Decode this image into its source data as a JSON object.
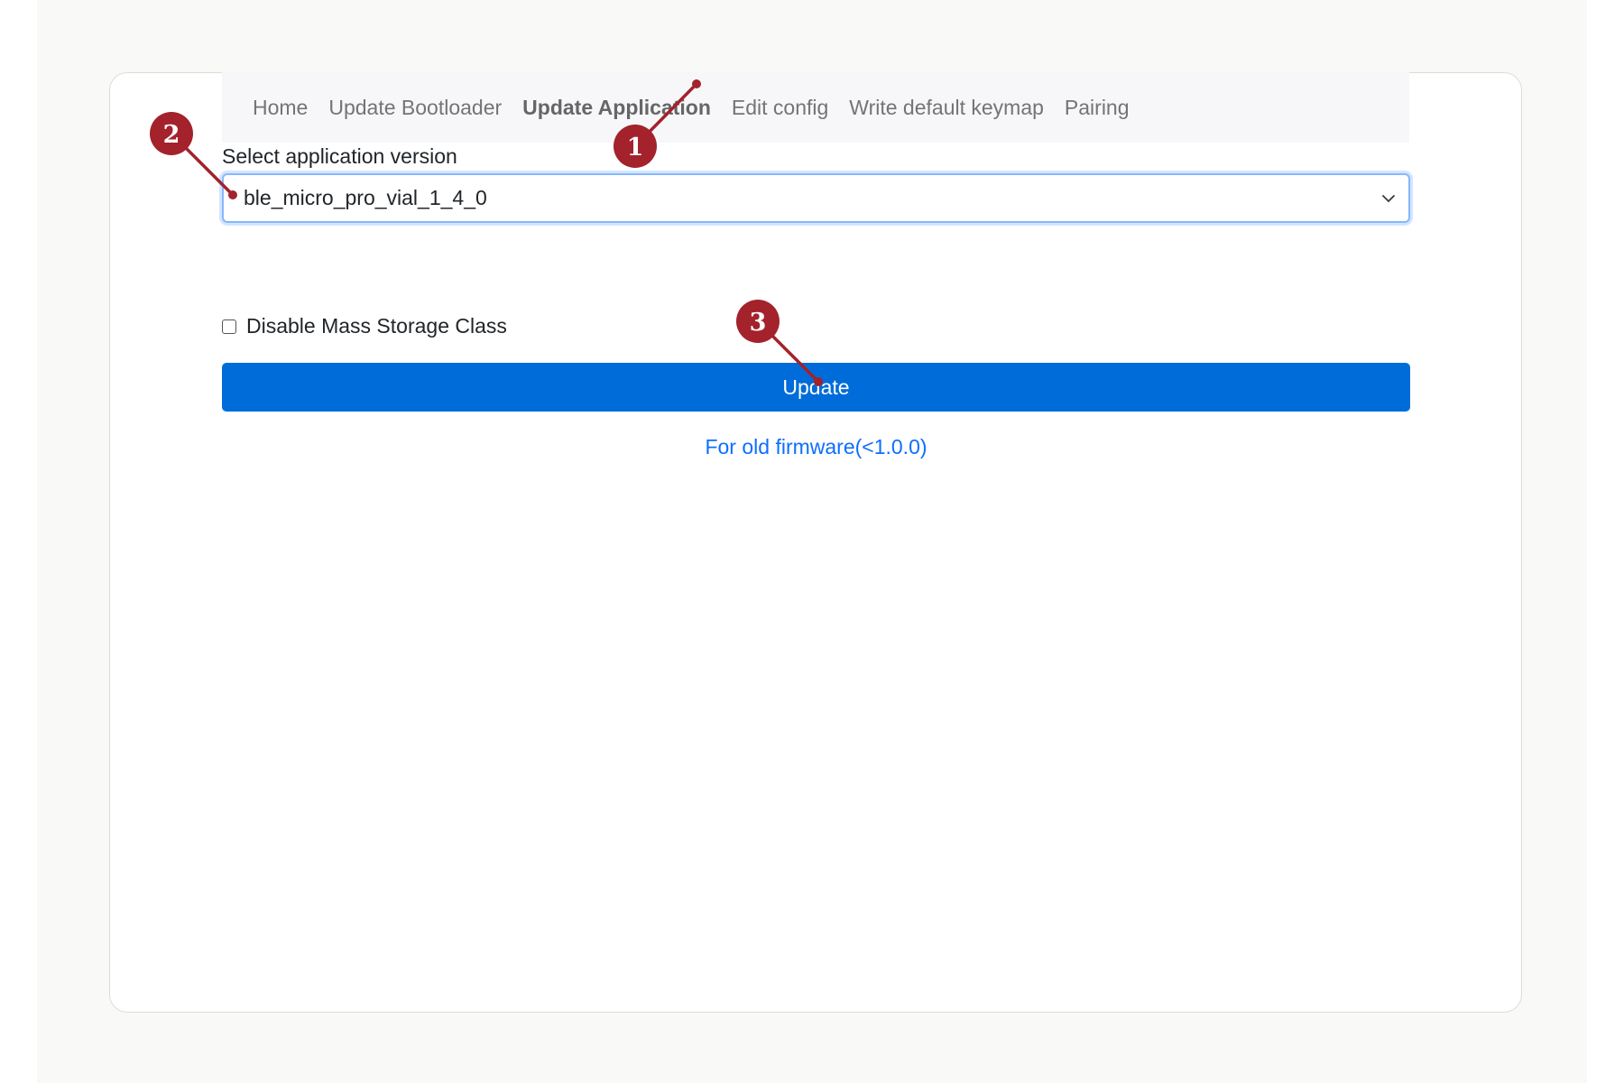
{
  "nav": {
    "items": [
      {
        "label": "Home",
        "active": false
      },
      {
        "label": "Update Bootloader",
        "active": false
      },
      {
        "label": "Update Application",
        "active": true
      },
      {
        "label": "Edit config",
        "active": false
      },
      {
        "label": "Write default keymap",
        "active": false
      },
      {
        "label": "Pairing",
        "active": false
      }
    ]
  },
  "form": {
    "select_label": "Select application version",
    "selected_version": "ble_micro_pro_vial_1_4_0",
    "checkbox_label": "Disable Mass Storage Class",
    "checkbox_checked": false,
    "update_button_label": "Update",
    "old_firmware_link": "For old firmware(<1.0.0)"
  },
  "annotations": {
    "color": "#a3222c",
    "badges": [
      {
        "number": "1"
      },
      {
        "number": "2"
      },
      {
        "number": "3"
      }
    ]
  },
  "colors": {
    "primary_button": "#006cd9",
    "link": "#0d6efd",
    "focus_border": "#86b7fe"
  }
}
